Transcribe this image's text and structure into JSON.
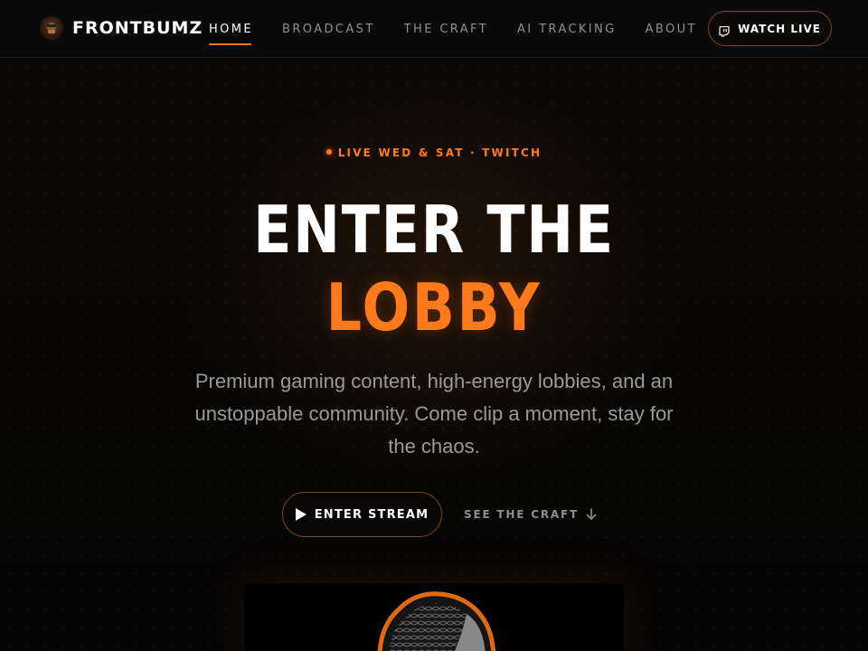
{
  "nav": {
    "brand": {
      "name": "FRONTBUMZ",
      "logo_icon": "mascot-logo-icon"
    },
    "links": [
      {
        "label": "HOME",
        "active": true
      },
      {
        "label": "BROADCAST",
        "active": false
      },
      {
        "label": "THE CRAFT",
        "active": false
      },
      {
        "label": "AI TRACKING",
        "active": false
      },
      {
        "label": "ABOUT",
        "active": false
      }
    ],
    "watch_button": {
      "label": "WATCH LIVE",
      "icon": "twitch-icon"
    }
  },
  "hero": {
    "eyebrow": "LIVE WED & SAT · TWITCH",
    "headline_line1": "ENTER THE",
    "headline_line2": "LOBBY",
    "subcopy": "Premium gaming content, high-energy lobbies, and an unstoppable community. Come clip a moment, stay for the chaos.",
    "primary_cta": {
      "label": "ENTER STREAM",
      "icon": "play-icon"
    },
    "secondary_cta": {
      "label": "SEE THE CRAFT",
      "icon": "arrow-down-icon"
    }
  },
  "colors": {
    "accent": "#ff7a1a",
    "background": "#050505",
    "nav_text": "#8f8f8f",
    "body_text": "#9a9a9a"
  }
}
